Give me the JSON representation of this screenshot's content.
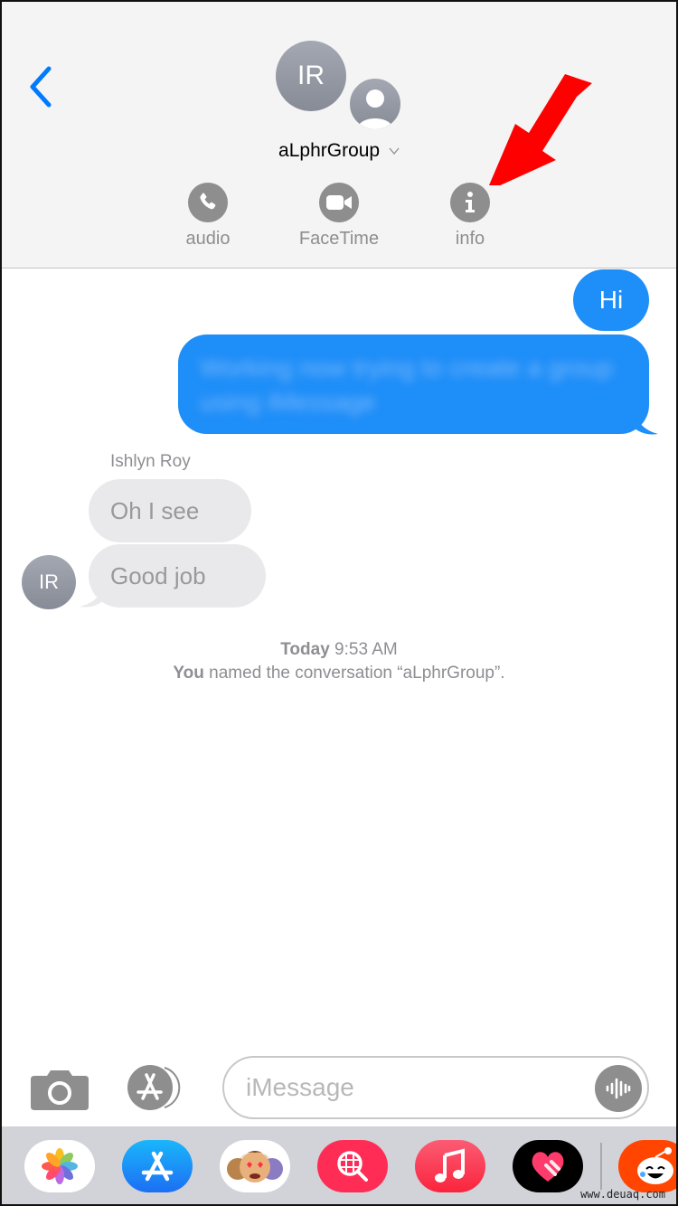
{
  "header": {
    "back_label": "Back",
    "avatar_initials": "IR",
    "group_name": "aLphrGroup",
    "actions": [
      {
        "label": "audio",
        "icon": "phone-icon"
      },
      {
        "label": "FaceTime",
        "icon": "video-camera-icon"
      },
      {
        "label": "info",
        "icon": "info-icon"
      }
    ]
  },
  "annotation": {
    "arrow_color": "#ff0000",
    "points_to": "info"
  },
  "messages": {
    "outgoing": [
      {
        "text": "Hi"
      },
      {
        "text": "Working now trying to create a group using iMessage",
        "blurred": true
      }
    ],
    "sender_name": "Ishlyn Roy",
    "sender_initials": "IR",
    "incoming": [
      {
        "text": "Oh I see",
        "blurred": true
      },
      {
        "text": "Good job",
        "blurred": true
      }
    ]
  },
  "system": {
    "day": "Today",
    "time": "9:53 AM",
    "actor": "You",
    "event": "named the conversation “aLphrGroup”."
  },
  "compose": {
    "placeholder": "iMessage",
    "value": ""
  },
  "app_drawer": [
    {
      "name": "Photos"
    },
    {
      "name": "App Store"
    },
    {
      "name": "Memoji Stickers"
    },
    {
      "name": "Images Search"
    },
    {
      "name": "Music"
    },
    {
      "name": "Digital Touch"
    },
    {
      "name": "Reddit"
    }
  ],
  "colors": {
    "accent": "#007aff",
    "outgoing_bubble": "#1e8ef8",
    "incoming_bubble": "#e9e9eb",
    "icon_gray": "#8e8e8e"
  },
  "watermark": "www.deuaq.com"
}
